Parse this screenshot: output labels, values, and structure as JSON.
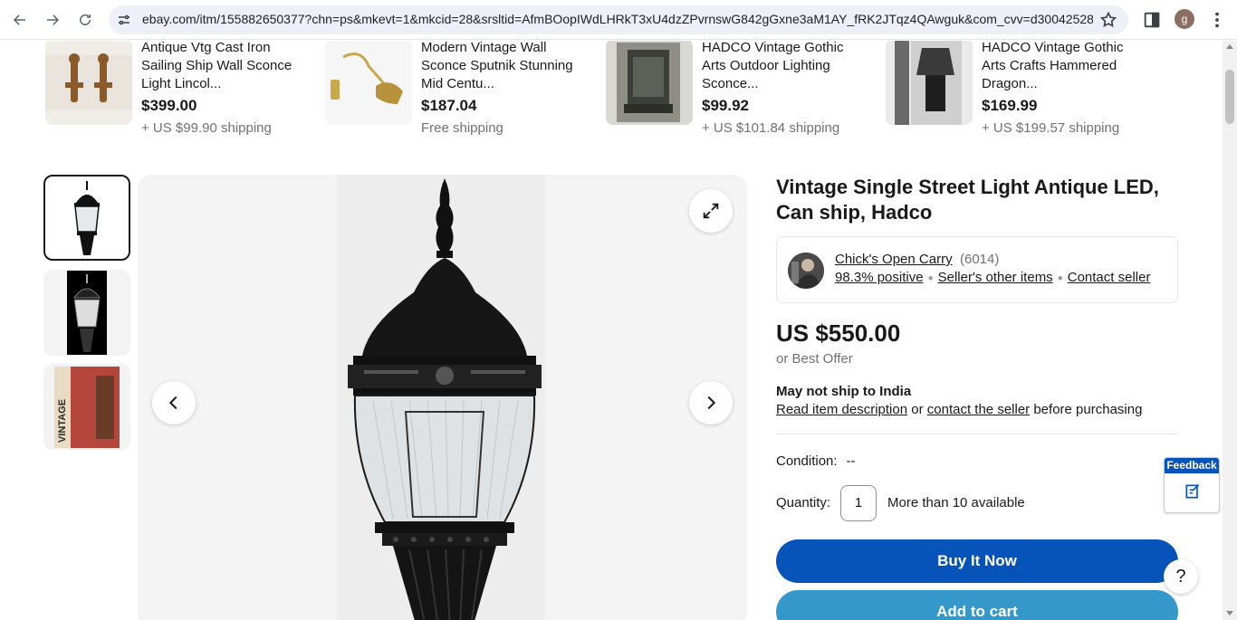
{
  "browser": {
    "url": "ebay.com/itm/155882650377?chn=ps&mkevt=1&mkcid=28&srsltid=AfmBOopIWdLHRkT3xU4dzZPvrnswG842gGxne3aM1AY_fRK2JTqz4QAwguk&com_cvv=d30042528f...",
    "profile_initial": "g"
  },
  "related_items": [
    {
      "title": "Antique Vtg Cast Iron Sailing Ship Wall Sconce Light Lincol...",
      "price": "$399.00",
      "shipping": "+ US $99.90 shipping"
    },
    {
      "title": "Modern Vintage Wall Sconce Sputnik Stunning Mid Centu...",
      "price": "$187.04",
      "shipping": "Free shipping"
    },
    {
      "title": "HADCO Vintage Gothic Arts Outdoor Lighting Sconce...",
      "price": "$99.92",
      "shipping": "+ US $101.84 shipping"
    },
    {
      "title": "HADCO Vintage Gothic Arts Crafts Hammered Dragon...",
      "price": "$169.99",
      "shipping": "+ US $199.57 shipping"
    }
  ],
  "listing": {
    "title": "Vintage Single Street Light Antique LED, Can ship, Hadco",
    "seller": {
      "name": "Chick's Open Carry",
      "count": "(6014)",
      "positive": "98.3% positive",
      "other_items": "Seller's other items",
      "contact": "Contact seller"
    },
    "price": "US $550.00",
    "best_offer": "or Best Offer",
    "shipping_warning": {
      "title": "May not ship to India",
      "read_link": "Read item description",
      "or": "or",
      "contact_link": "contact the seller",
      "suffix": "before purchasing"
    },
    "condition_label": "Condition:",
    "condition_value": "--",
    "quantity_label": "Quantity:",
    "quantity_value": "1",
    "availability": "More than 10 available",
    "buy_now": "Buy It Now",
    "add_to_cart": "Add to cart"
  },
  "thumbnail_3_text": "VINTAGE",
  "feedback_label": "Feedback",
  "help_label": "?"
}
